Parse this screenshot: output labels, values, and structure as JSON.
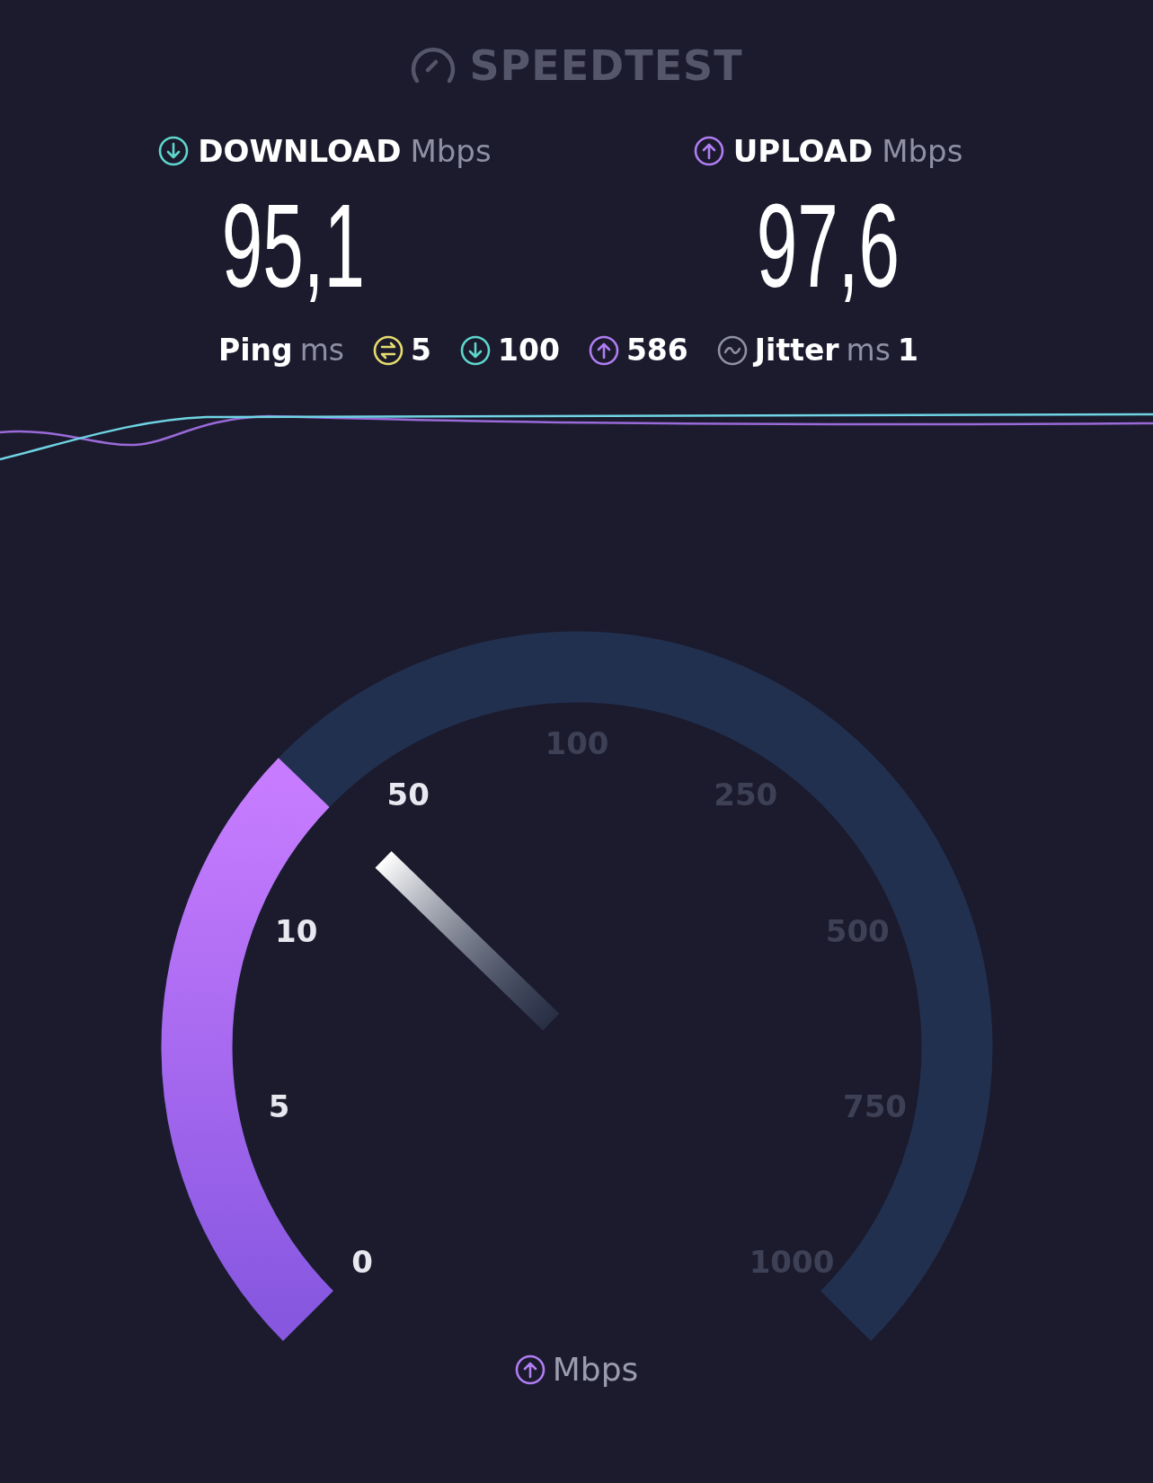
{
  "logo": {
    "text": "SPEEDTEST"
  },
  "results": [
    {
      "kind": "download",
      "label": "DOWNLOAD",
      "unit": "Mbps",
      "value": "95,1"
    },
    {
      "kind": "upload",
      "label": "UPLOAD",
      "unit": "Mbps",
      "value": "97,6"
    }
  ],
  "ping": {
    "label": "Ping",
    "unit": "ms",
    "stats": [
      {
        "kind": "idle",
        "value": "5"
      },
      {
        "kind": "download",
        "value": "100"
      },
      {
        "kind": "upload",
        "value": "586"
      }
    ]
  },
  "jitter": {
    "label": "Jitter",
    "unit": "ms",
    "value": "1"
  },
  "gauge": {
    "unit": "Mbps",
    "ticks": [
      {
        "label": "0",
        "reached": true
      },
      {
        "label": "5",
        "reached": true
      },
      {
        "label": "10",
        "reached": true
      },
      {
        "label": "50",
        "reached": true
      },
      {
        "label": "100",
        "reached": false
      },
      {
        "label": "250",
        "reached": false
      },
      {
        "label": "500",
        "reached": false
      },
      {
        "label": "750",
        "reached": false
      },
      {
        "label": "1000",
        "reached": false
      }
    ]
  }
}
